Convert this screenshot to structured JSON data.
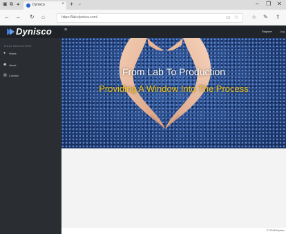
{
  "browser": {
    "tab_title": "Dynisco",
    "tab_close": "×",
    "new_tab": "+",
    "tab_menu": "⌄",
    "nav": {
      "back": "←",
      "forward": "→",
      "refresh": "↻",
      "home": "⌂"
    },
    "url": "https://lab.dynisco.com/",
    "window_controls": {
      "minimize": "–",
      "restore": "❐",
      "close": "✕"
    }
  },
  "site": {
    "brand": "Dynisco",
    "sidebar": {
      "heading": "MAIN NAVIGATION",
      "items": [
        {
          "icon": "home-icon",
          "label": "Home"
        },
        {
          "icon": "info-icon",
          "label": "About"
        },
        {
          "icon": "contact-card-icon",
          "label": "Contact"
        }
      ]
    },
    "topbar": {
      "menu": "≡",
      "register": "Register",
      "login": "Log"
    },
    "hero": {
      "title": "From Lab To Production",
      "subtitle": "Providing A Window Into The Process"
    },
    "footer": "© 2018 Dynisc"
  },
  "colors": {
    "sidebar_bg": "#2a2e32",
    "topbar_bg": "#212529",
    "hero_subtitle": "#f1c51c",
    "brand_blue": "#3c78d8"
  }
}
